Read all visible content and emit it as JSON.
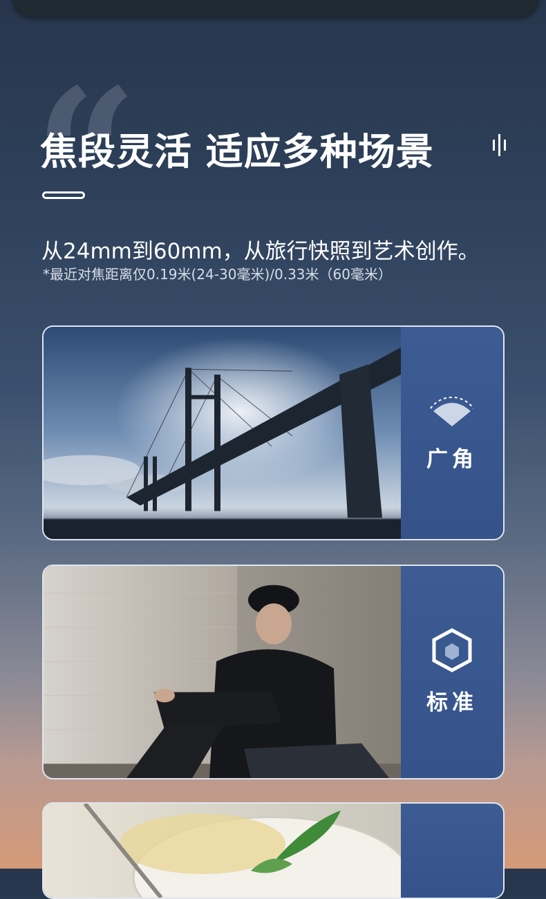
{
  "header": {
    "headline": "焦段灵活 适应多种场景",
    "subtitle": "从24mm到60mm，从旅行快照到艺术创作。",
    "footnote": "*最近对焦距离仅0.19米(24-30毫米)/0.33米（60毫米）"
  },
  "cards": [
    {
      "label": "广角",
      "icon": "wide-angle-icon",
      "image": "bridge-photo"
    },
    {
      "label": "标准",
      "icon": "hexagon-icon",
      "image": "portrait-photo"
    },
    {
      "label": "",
      "icon": "",
      "image": "food-photo"
    }
  ],
  "colors": {
    "accent_panel": "#3d5c93",
    "card_border": "#dfe6f0",
    "top_bar": "#1e2932"
  }
}
